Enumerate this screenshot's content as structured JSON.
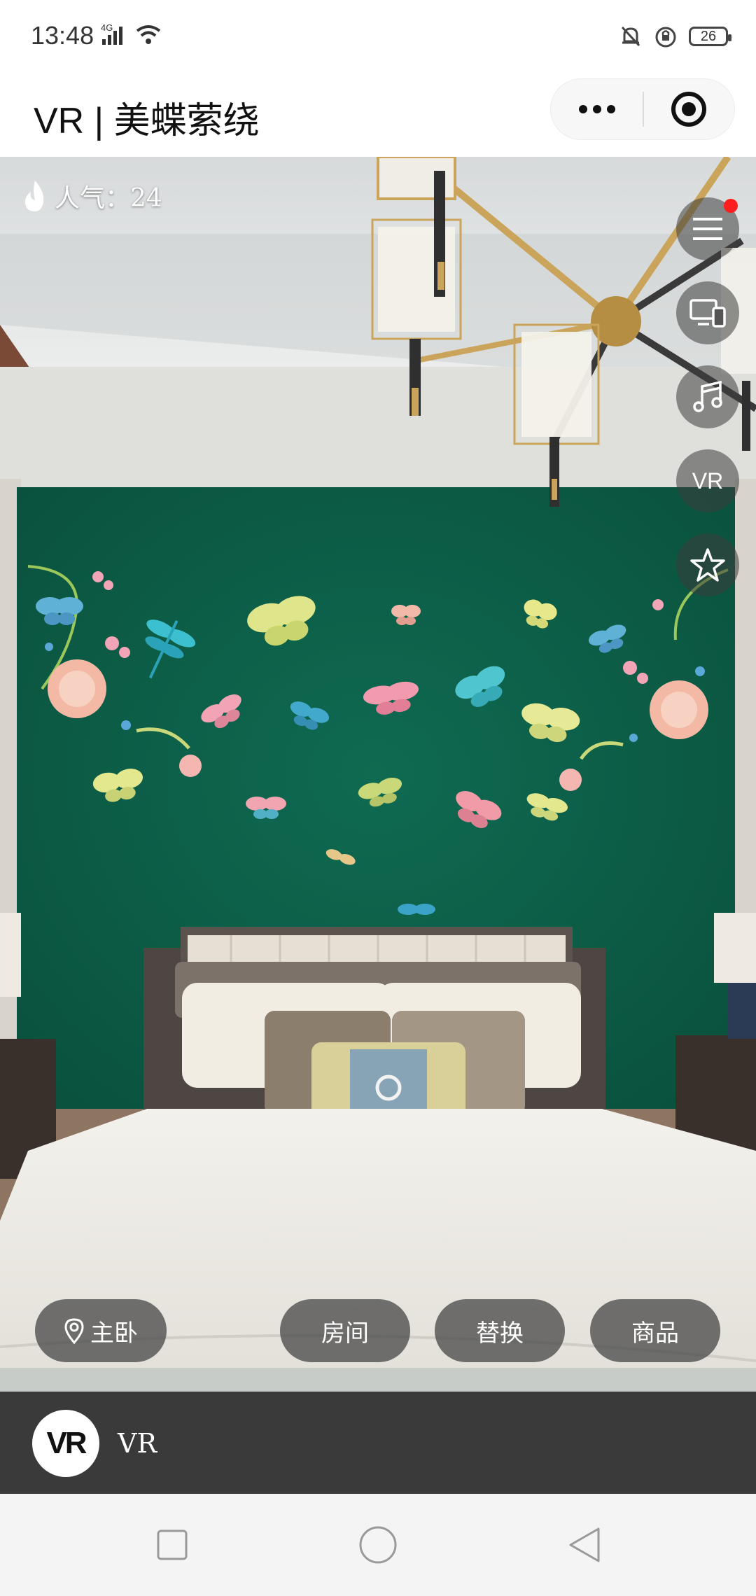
{
  "status_bar": {
    "time": "13:48",
    "network": "4G",
    "battery": "26",
    "icons": [
      "signal-icon",
      "wifi-icon",
      "mute-icon",
      "alarm-icon",
      "battery-icon"
    ]
  },
  "title_bar": {
    "title": "VR | 美蝶萦绕",
    "more_icon": "more-dots-icon",
    "close_icon": "target-close-icon"
  },
  "scene": {
    "popularity_text": "人气：24",
    "popularity_icon": "flame-icon",
    "side_buttons": [
      {
        "name": "menu",
        "icon": "menu-icon",
        "badge": true
      },
      {
        "name": "screen",
        "icon": "devices-icon"
      },
      {
        "name": "music",
        "icon": "music-note-icon"
      },
      {
        "name": "vr",
        "label": "VR"
      },
      {
        "name": "favorite",
        "icon": "star-icon"
      }
    ],
    "location_label": "主卧",
    "location_icon": "location-pin-icon",
    "bottom_buttons": [
      {
        "label": "房间"
      },
      {
        "label": "替换"
      },
      {
        "label": "商品"
      }
    ]
  },
  "footer": {
    "logo_text": "VR",
    "label": "VR"
  },
  "nav_bar": {
    "icons": [
      "square-recents-icon",
      "circle-home-icon",
      "triangle-back-icon"
    ]
  },
  "colors": {
    "wall_green": "#0b5e47",
    "button_overlay": "#464646",
    "footer_bg": "#3a3a3a",
    "badge_red": "#ff1e1e"
  }
}
